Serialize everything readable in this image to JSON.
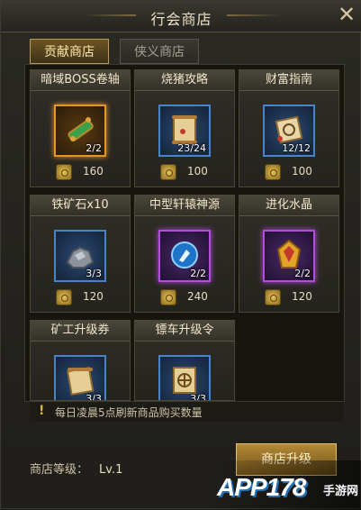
{
  "window": {
    "title": "行会商店"
  },
  "tabs": [
    {
      "label": "贡献商店"
    },
    {
      "label": "侠义商店"
    }
  ],
  "items": [
    {
      "name": "暗域BOSS卷轴",
      "count": "2/2",
      "price": "160",
      "icon": "scroll-icon",
      "quality": "orange"
    },
    {
      "name": "烧猪攻略",
      "count": "23/24",
      "price": "100",
      "icon": "scroll-icon",
      "quality": "blue"
    },
    {
      "name": "财富指南",
      "count": "12/12",
      "price": "100",
      "icon": "scroll-icon",
      "quality": "blue"
    },
    {
      "name": "铁矿石x10",
      "count": "3/3",
      "price": "120",
      "icon": "ore-icon",
      "quality": "blue"
    },
    {
      "name": "中型轩辕神源",
      "count": "2/2",
      "price": "240",
      "icon": "orb-icon",
      "quality": "purple"
    },
    {
      "name": "进化水晶",
      "count": "2/2",
      "price": "120",
      "icon": "crystal-icon",
      "quality": "purple"
    },
    {
      "name": "矿工升级券",
      "count": "3/3",
      "price": "",
      "icon": "scroll-icon",
      "quality": "blue"
    },
    {
      "name": "镖车升级令",
      "count": "3/3",
      "price": "",
      "icon": "scroll-icon",
      "quality": "blue"
    }
  ],
  "notice": {
    "icon": "exclamation-icon",
    "text": "每日凌晨5点刷新商品购买数量"
  },
  "footer": {
    "level_label": "商店等级：",
    "level_value": "Lv.1",
    "upgrade_label": "商店升级"
  },
  "watermark": {
    "main": "APP178",
    "sub": "手游网"
  },
  "colors": {
    "accent_gold": "#b89a55",
    "quality_orange": "#e3952a",
    "quality_purple": "#b14ed8",
    "quality_blue": "#4a84c8"
  }
}
